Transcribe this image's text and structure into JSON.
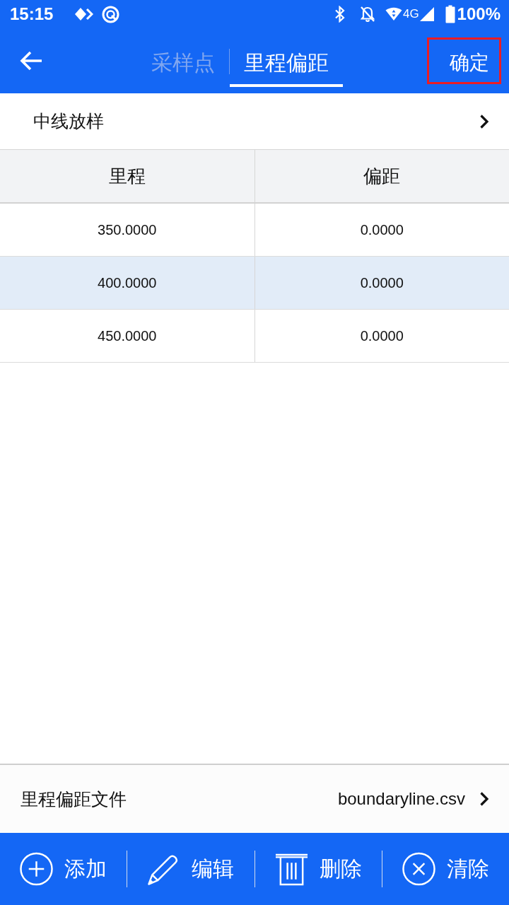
{
  "status_bar": {
    "time": "15:15",
    "network": "4G",
    "battery": "100%"
  },
  "app_bar": {
    "tabs": [
      {
        "label": "采样点",
        "selected": false
      },
      {
        "label": "里程偏距",
        "selected": true
      }
    ],
    "confirm": {
      "label": "确定",
      "highlighted": true
    }
  },
  "section": {
    "label": "中线放样"
  },
  "table": {
    "columns": [
      "里程",
      "偏距"
    ],
    "rows": [
      {
        "cells": [
          "350.0000",
          "0.0000"
        ],
        "selected": false
      },
      {
        "cells": [
          "400.0000",
          "0.0000"
        ],
        "selected": true
      },
      {
        "cells": [
          "450.0000",
          "0.0000"
        ],
        "selected": false
      }
    ]
  },
  "file_row": {
    "label": "里程偏距文件",
    "value": "boundaryline.csv"
  },
  "toolbar": [
    {
      "kind": "add",
      "label": "添加"
    },
    {
      "kind": "edit",
      "label": "编辑"
    },
    {
      "kind": "delete",
      "label": "删除"
    },
    {
      "kind": "clear",
      "label": "清除"
    }
  ]
}
